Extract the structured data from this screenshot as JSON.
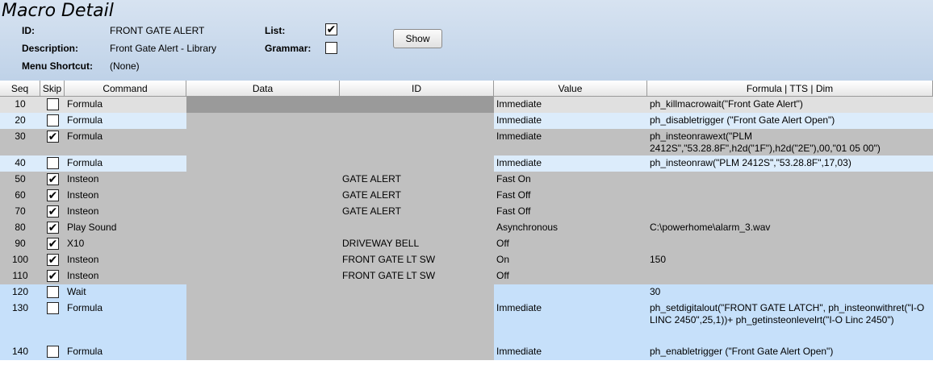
{
  "page": {
    "title": "Macro Detail"
  },
  "form": {
    "id_label": "ID:",
    "id_value": "FRONT GATE ALERT",
    "desc_label": "Description:",
    "desc_value": "Front Gate Alert - Library",
    "menu_label": "Menu Shortcut:",
    "menu_value": "(None)",
    "list_label": "List:",
    "list_checked": true,
    "grammar_label": "Grammar:",
    "grammar_checked": false,
    "show_button": "Show"
  },
  "grid": {
    "columns": [
      "Seq",
      "Skip",
      "Command",
      "Data",
      "ID",
      "Value",
      "Formula | TTS | Dim"
    ],
    "rows": [
      {
        "seq": "10",
        "skip": false,
        "command": "Formula",
        "data": "",
        "id": "",
        "value": "Immediate",
        "formula": "ph_killmacrowait(\"Front Gate Alert\")"
      },
      {
        "seq": "20",
        "skip": false,
        "command": "Formula",
        "data": "",
        "id": "",
        "value": "Immediate",
        "formula": "ph_disabletrigger (\"Front Gate Alert Open\")"
      },
      {
        "seq": "30",
        "skip": true,
        "command": "Formula",
        "data": "",
        "id": "",
        "value": "Immediate",
        "formula": "ph_insteonrawext(\"PLM 2412S\",\"53.28.8F\",h2d(\"1F\"),h2d(\"2E\"),00,\"01 05 00\")"
      },
      {
        "seq": "40",
        "skip": false,
        "command": "Formula",
        "data": "",
        "id": "",
        "value": "Immediate",
        "formula": "ph_insteonraw(\"PLM 2412S\",\"53.28.8F\",17,03)"
      },
      {
        "seq": "50",
        "skip": true,
        "command": "Insteon",
        "data": "",
        "id": "GATE ALERT",
        "value": "Fast On",
        "formula": ""
      },
      {
        "seq": "60",
        "skip": true,
        "command": "Insteon",
        "data": "",
        "id": "GATE ALERT",
        "value": "Fast Off",
        "formula": ""
      },
      {
        "seq": "70",
        "skip": true,
        "command": "Insteon",
        "data": "",
        "id": "GATE ALERT",
        "value": "Fast Off",
        "formula": ""
      },
      {
        "seq": "80",
        "skip": true,
        "command": "Play Sound",
        "data": "",
        "id": "",
        "value": "Asynchronous",
        "formula": "C:\\powerhome\\alarm_3.wav"
      },
      {
        "seq": "90",
        "skip": true,
        "command": "X10",
        "data": "",
        "id": "DRIVEWAY BELL",
        "value": "Off",
        "formula": ""
      },
      {
        "seq": "100",
        "skip": true,
        "command": "Insteon",
        "data": "",
        "id": "FRONT GATE LT SW",
        "value": "On",
        "formula": "150"
      },
      {
        "seq": "110",
        "skip": true,
        "command": "Insteon",
        "data": "",
        "id": "FRONT GATE LT SW",
        "value": "Off",
        "formula": ""
      },
      {
        "seq": "120",
        "skip": false,
        "command": "Wait",
        "data": "",
        "id": "",
        "value": "",
        "formula": "30"
      },
      {
        "seq": "130",
        "skip": false,
        "command": "Formula",
        "data": "",
        "id": "",
        "value": "Immediate",
        "formula": "ph_setdigitalout(\"FRONT GATE LATCH\", ph_insteonwithret(\"I-O LINC 2450\",25,1))+ ph_getinsteonlevelrt(\"I-O Linc 2450\")"
      },
      {
        "seq": "140",
        "skip": false,
        "command": "Formula",
        "data": "",
        "id": "",
        "value": "Immediate",
        "formula": "ph_enabletrigger (\"Front Gate Alert Open\")"
      }
    ]
  },
  "colors": {
    "header_bg": "#c8d9ed",
    "row_disabled": "#c0c0c0",
    "row_selected": "#e0e0e0",
    "row_enabled_light": "#dcecfb",
    "row_enabled": "#c6e0fa"
  }
}
